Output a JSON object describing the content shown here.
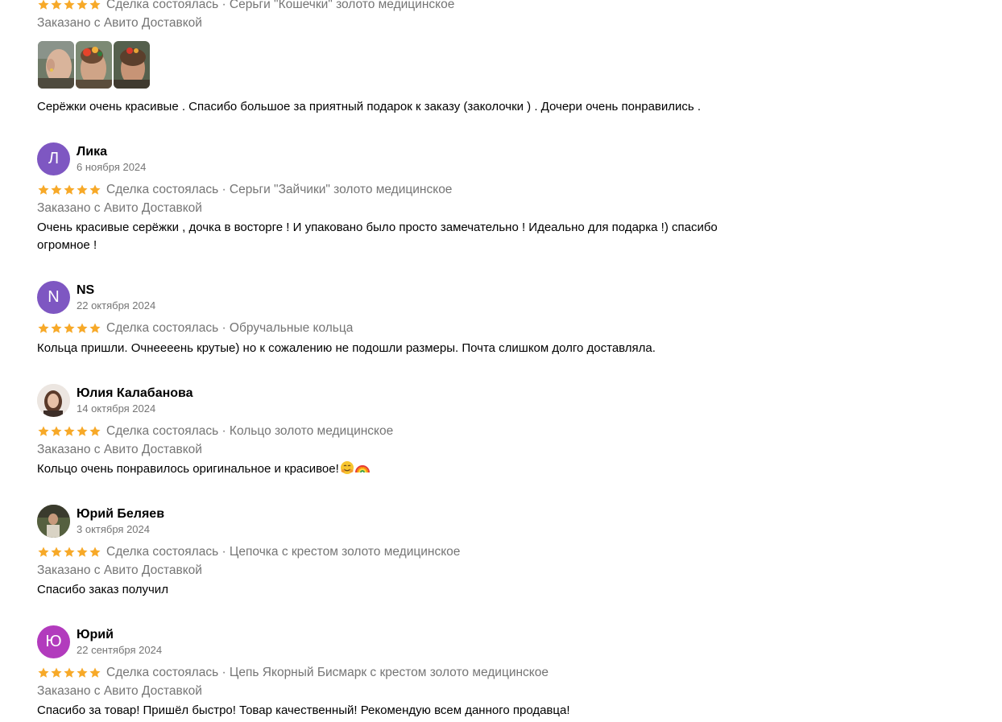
{
  "colors": {
    "star": "#f7a928",
    "muted": "#757575",
    "text": "#000000",
    "avatar_purple": "#7e57c2",
    "avatar_violet": "#9c4fc4",
    "avatar_magenta": "#b23bbd"
  },
  "reviews": [
    {
      "meta": "Сделка состоялась · Серьги \"Кошечки\" золото медицинское",
      "delivery": "Заказано с Авито Доставкой",
      "photos": 3,
      "text": "Серёжки очень красивые . Спасибо большое за приятный подарок к заказу (заколочки ) . Дочери очень понравились ."
    },
    {
      "name": "Лика",
      "avatar_letter": "Л",
      "date": "6 ноября 2024",
      "rating": 5,
      "meta": "Сделка состоялась · Серьги \"Зайчики\" золото медицинское",
      "delivery": "Заказано с Авито Доставкой",
      "text_line1": "Очень красивые серёжки , дочка в восторге ! И упаковано было просто замечательно ! Идеально для подарка !) спасибо",
      "text_line2": "огромное !"
    },
    {
      "name": "NS",
      "avatar_letter": "N",
      "date": "22 октября 2024",
      "rating": 5,
      "meta": "Сделка состоялась · Обручальные кольца",
      "text": "Кольца пришли. Очнееeень крутые) но к сожалению не подошли размеры. Почта слишком долго доставляла."
    },
    {
      "name": "Юлия Калабанова",
      "date": "14 октября 2024",
      "rating": 5,
      "meta": "Сделка состоялась · Кольцо золото медицинское",
      "delivery": "Заказано с Авито Доставкой",
      "text": "Кольцо очень понравилось оригинальное и красивое!",
      "emojis": [
        "smiling-hug-emoji",
        "rainbow-emoji"
      ]
    },
    {
      "name": "Юрий Беляев",
      "date": "3 октября 2024",
      "rating": 5,
      "meta": "Сделка состоялась · Цепочка с крестом золото медицинское",
      "delivery": "Заказано с Авито Доставкой",
      "text": "Спасибо заказ получил"
    },
    {
      "name": "Юрий",
      "avatar_letter": "Ю",
      "date": "22 сентября 2024",
      "rating": 5,
      "meta": "Сделка состоялась · Цепь Якорный Бисмарк с крестом золото медицинское",
      "delivery": "Заказано с Авито Доставкой",
      "text": "Спасибо за товар! Пришёл быстро! Товар качественный! Рекомендую всем данного продавца!"
    }
  ]
}
